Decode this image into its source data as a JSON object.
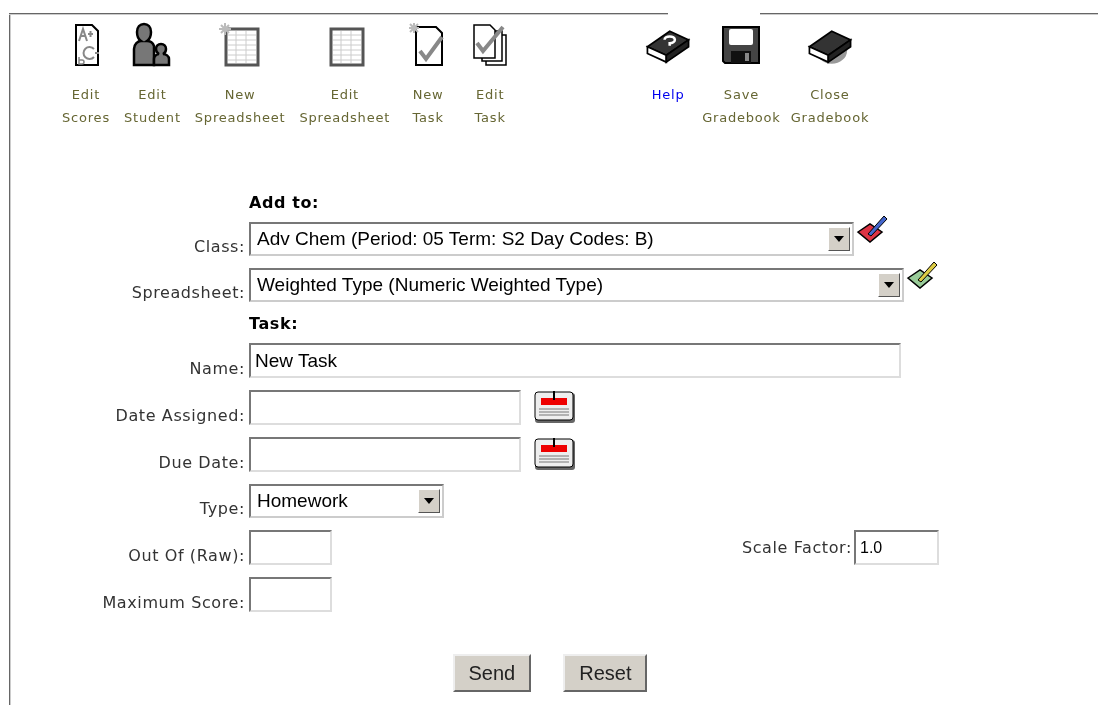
{
  "toolbar_left": [
    {
      "label": "Edit\nScores",
      "kind": "button"
    },
    {
      "label": "Edit\nStudent",
      "kind": "button"
    },
    {
      "label": "New\nSpreadsheet",
      "kind": "button"
    },
    {
      "label": "Edit\nSpreadsheet",
      "kind": "button"
    },
    {
      "label": "New\nTask",
      "kind": "button"
    },
    {
      "label": "Edit\nTask",
      "kind": "button"
    }
  ],
  "toolbar_right": [
    {
      "label": "Help",
      "kind": "link"
    },
    {
      "label": "Save\nGradebook",
      "kind": "button"
    },
    {
      "label": "Close\nGradebook",
      "kind": "button"
    }
  ],
  "form": {
    "add_to_heading": "Add to:",
    "class": {
      "label": "Class:",
      "value": "Adv Chem (Period: 05 Term: S2 Day Codes: B)"
    },
    "spreadsheet": {
      "label": "Spreadsheet:",
      "value": "Weighted Type (Numeric Weighted Type)"
    },
    "task_heading": "Task:",
    "name": {
      "label": "Name:",
      "value": "New Task"
    },
    "date_assigned": {
      "label": "Date Assigned:"
    },
    "due_date": {
      "label": "Due Date:"
    },
    "type": {
      "label": "Type:",
      "value": "Homework"
    },
    "out_of": {
      "label": "Out Of (Raw):"
    },
    "scale_factor": {
      "label": "Scale Factor:",
      "value": "1.0"
    },
    "maximum_score": {
      "label": "Maximum Score:"
    }
  },
  "buttons": [
    "Send",
    "Reset"
  ]
}
